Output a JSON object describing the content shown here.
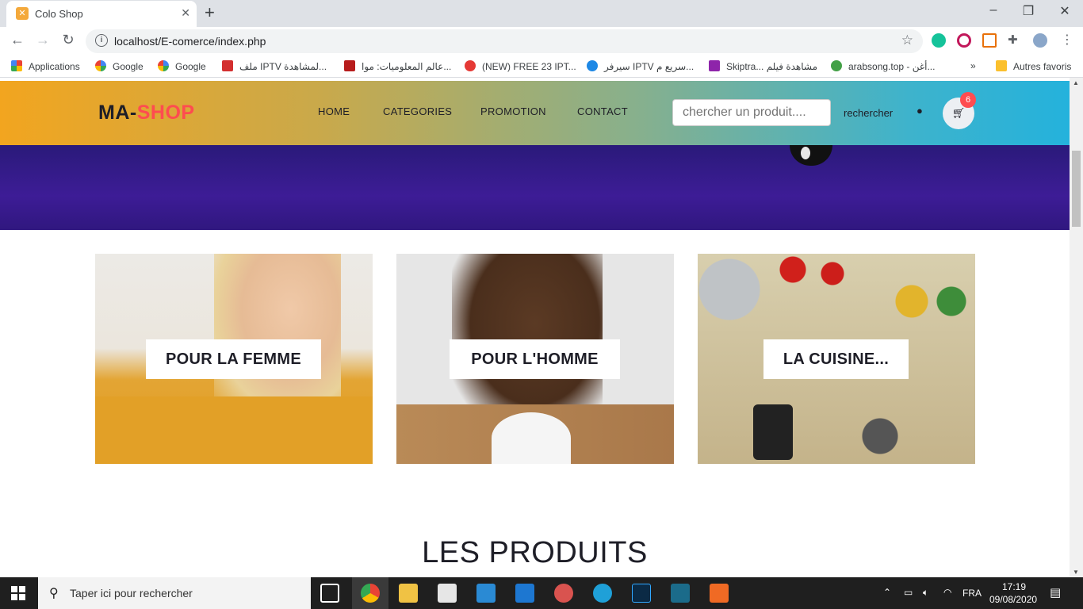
{
  "browser": {
    "tab_title": "Colo Shop",
    "url": "localhost/E-comerce/index.php",
    "bookmarks": [
      "Applications",
      "Google",
      "Google",
      "ملف IPTV لمشاهدة...",
      "عالم المعلوميات: موا...",
      "(NEW) FREE 23 IPT...",
      "سيرفر IPTV سريع م...",
      "Skiptra... مشاهدة فيلم",
      "arabsong.top - أغن...",
      "Autres favoris"
    ]
  },
  "site": {
    "logo_ma": "MA-",
    "logo_shop": "SHOP",
    "nav": [
      "HOME",
      "CATEGORIES",
      "PROMOTION",
      "CONTACT"
    ],
    "search_placeholder": "chercher un produit....",
    "search_button": "rechercher",
    "cart_count": "6",
    "categories": [
      {
        "label": "POUR LA FEMME"
      },
      {
        "label": "POUR L'HOMME"
      },
      {
        "label": "LA CUISINE..."
      }
    ],
    "section_title": "LES PRODUITS"
  },
  "taskbar": {
    "search_placeholder": "Taper ici pour rechercher",
    "language": "FRA",
    "time": "17:19",
    "date": "09/08/2020"
  },
  "colors": {
    "accent": "#fe4c50",
    "header_left": "#f2a51f",
    "header_right": "#24b2dc",
    "hero": "#3d1c96"
  }
}
